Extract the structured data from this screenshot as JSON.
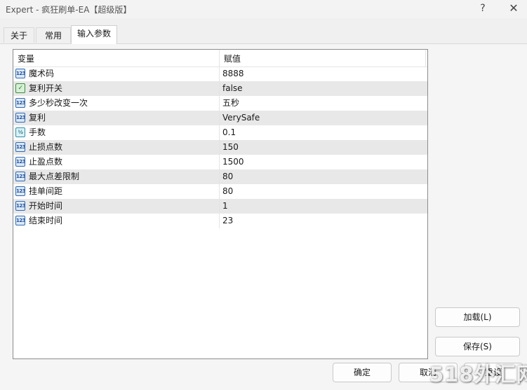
{
  "window": {
    "title": "Expert - 疯狂刷单-EA【超级版】",
    "help_label": "?",
    "close_label": "✕"
  },
  "tabs": [
    {
      "label": "关于"
    },
    {
      "label": "常用"
    },
    {
      "label": "输入参数",
      "active": true
    }
  ],
  "grid": {
    "headers": {
      "variable": "变量",
      "value": "赋值"
    },
    "rows": [
      {
        "icon": "integer-icon",
        "icon_text": "123",
        "name": "魔术码",
        "value": "8888"
      },
      {
        "icon": "boolean-icon",
        "icon_text": "✓",
        "name": "复利开关",
        "value": "false"
      },
      {
        "icon": "integer-icon",
        "icon_text": "123",
        "name": "多少秒改变一次",
        "value": "五秒"
      },
      {
        "icon": "integer-icon",
        "icon_text": "123",
        "name": "复利",
        "value": "VerySafe"
      },
      {
        "icon": "double-icon",
        "icon_text": "½",
        "name": "手数",
        "value": "0.1"
      },
      {
        "icon": "integer-icon",
        "icon_text": "123",
        "name": "止损点数",
        "value": "150"
      },
      {
        "icon": "integer-icon",
        "icon_text": "123",
        "name": "止盈点数",
        "value": "1500"
      },
      {
        "icon": "integer-icon",
        "icon_text": "123",
        "name": "最大点差限制",
        "value": "80"
      },
      {
        "icon": "integer-icon",
        "icon_text": "123",
        "name": "挂单间距",
        "value": "80"
      },
      {
        "icon": "integer-icon",
        "icon_text": "123",
        "name": "开始时间",
        "value": "1"
      },
      {
        "icon": "integer-icon",
        "icon_text": "123",
        "name": "结束时间",
        "value": "23"
      }
    ]
  },
  "buttons": {
    "load": "加载(L)",
    "save": "保存(S)",
    "ok": "确定",
    "cancel": "取消",
    "reset": "重设"
  },
  "watermark": {
    "text": "518外汇网"
  }
}
